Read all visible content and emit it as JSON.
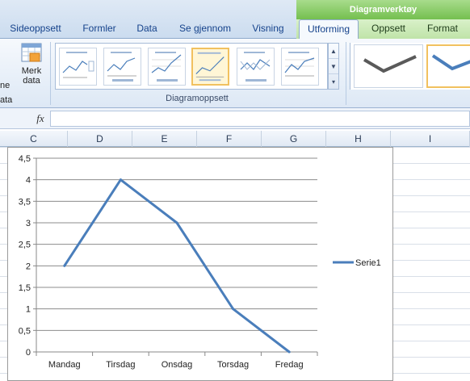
{
  "ribbon": {
    "context_group": "Diagramverktøy",
    "tabs": [
      {
        "label": "Sideoppsett"
      },
      {
        "label": "Formler"
      },
      {
        "label": "Data"
      },
      {
        "label": "Se gjennom"
      },
      {
        "label": "Visning"
      },
      {
        "label": "Utforming"
      },
      {
        "label": "Oppsett"
      },
      {
        "label": "Format"
      }
    ],
    "active_tab": "Utforming",
    "merk_data_line1": "Merk",
    "merk_data_line2": "data",
    "cut_left_1": "ne",
    "cut_left_2": "ata",
    "layout_group_label": "Diagramoppsett"
  },
  "formula_bar": {
    "fx_label": "fx",
    "value": ""
  },
  "columns": [
    "C",
    "D",
    "E",
    "F",
    "G",
    "H",
    "I"
  ],
  "chart_data": {
    "type": "line",
    "categories": [
      "Mandag",
      "Tirsdag",
      "Onsdag",
      "Torsdag",
      "Fredag"
    ],
    "series": [
      {
        "name": "Serie1",
        "values": [
          2,
          4,
          3,
          1,
          0
        ],
        "color": "#4a7ebb"
      }
    ],
    "ylim": [
      0,
      4.5
    ],
    "yticks": [
      "0",
      "0,5",
      "1",
      "1,5",
      "2",
      "2,5",
      "3",
      "3,5",
      "4",
      "4,5"
    ],
    "grid": true,
    "legend": "right"
  },
  "colors": {
    "context_tab_green": "#74bf4f",
    "ribbon_blue": "#dde8f5",
    "series_blue": "#4a7ebb"
  }
}
